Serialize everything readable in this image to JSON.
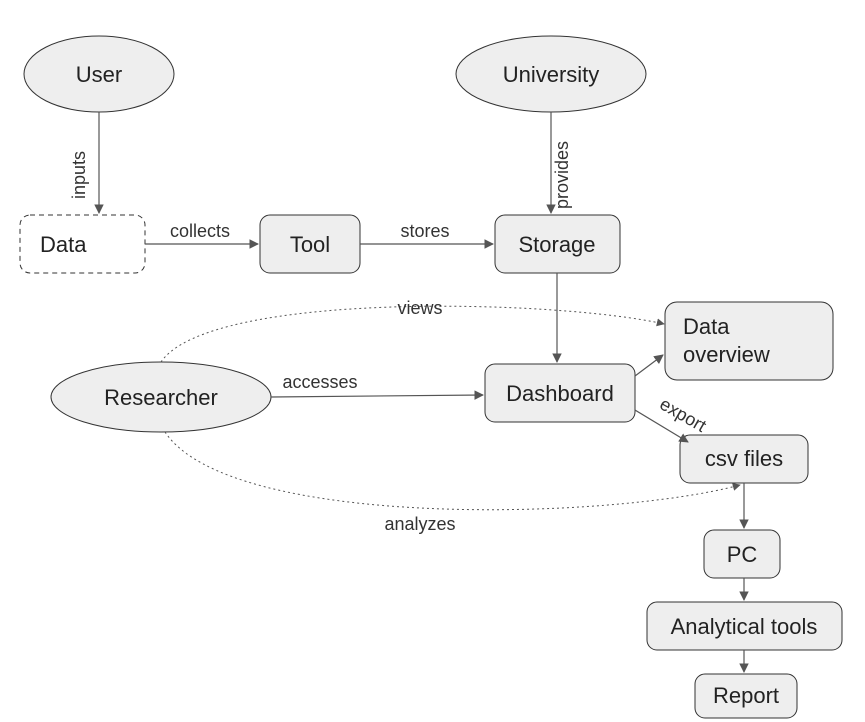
{
  "nodes": {
    "user": "User",
    "university": "University",
    "data": "Data",
    "tool": "Tool",
    "storage": "Storage",
    "researcher": "Researcher",
    "dashboard": "Dashboard",
    "data_overview_line1": "Data",
    "data_overview_line2": "overview",
    "csv_files": "csv files",
    "pc": "PC",
    "analytical_tools": "Analytical tools",
    "report": "Report"
  },
  "edges": {
    "inputs": "inputs",
    "collects": "collects",
    "stores": "stores",
    "provides": "provides",
    "views": "views",
    "accesses": "accesses",
    "export": "export",
    "analyzes": "analyzes"
  }
}
